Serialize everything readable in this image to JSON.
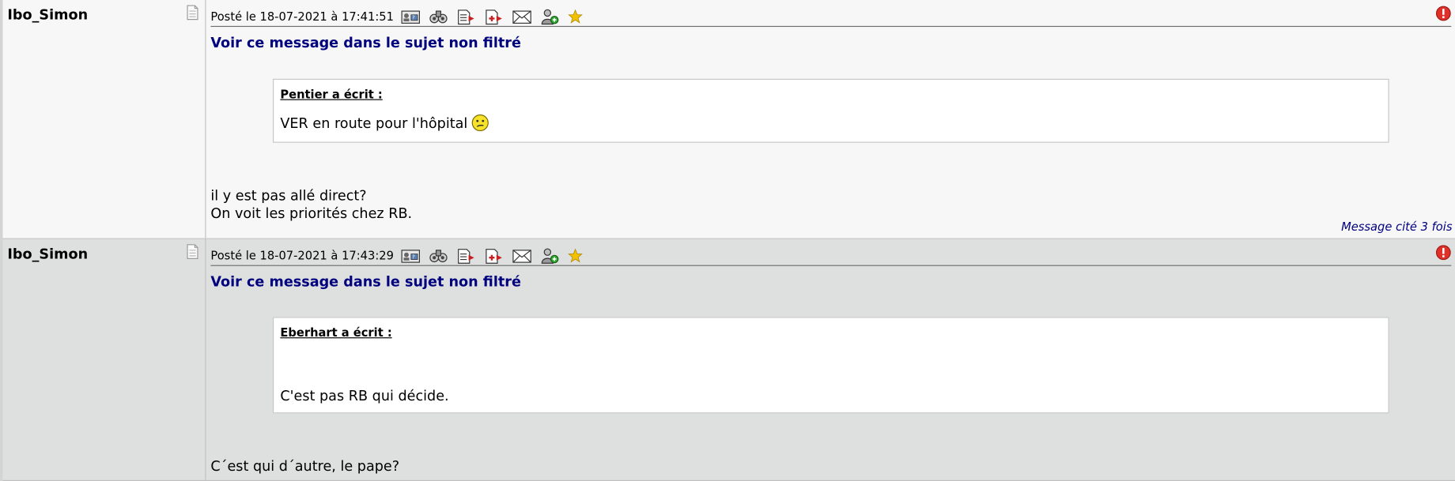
{
  "posts": [
    {
      "author": "Ibo_Simon",
      "date": "Posté le 18-07-2021 à 17:41:51",
      "view_link": "Voir ce message dans le sujet non filtré",
      "quote": {
        "author": "Pentier a écrit :",
        "text": "VER en route pour l'hôpital",
        "smiley": "confused-smiley-icon"
      },
      "body": [
        "il y est pas allé direct?",
        "On voit les priorités chez RB."
      ],
      "cited": "Message cité 3 fois"
    },
    {
      "author": "Ibo_Simon",
      "date": "Posté le 18-07-2021 à 17:43:29",
      "view_link": "Voir ce message dans le sujet non filtré",
      "quote": {
        "author": "Eberhart a écrit :",
        "text": "C'est pas RB qui décide."
      },
      "body": [
        "C´est qui d´autre, le pape?"
      ]
    }
  ],
  "toolbar_icons": [
    "profile-card-icon",
    "binoculars-icon",
    "quote-icon",
    "multi-quote-icon",
    "private-message-icon",
    "add-friend-icon",
    "favorite-star-icon"
  ],
  "colors": {
    "post_odd_bg": "#f7f7f7",
    "post_even_bg": "#dedfdf",
    "link_blue": "#00007f",
    "alert_red": "#e0302a",
    "star_yellow": "#f2c200"
  }
}
